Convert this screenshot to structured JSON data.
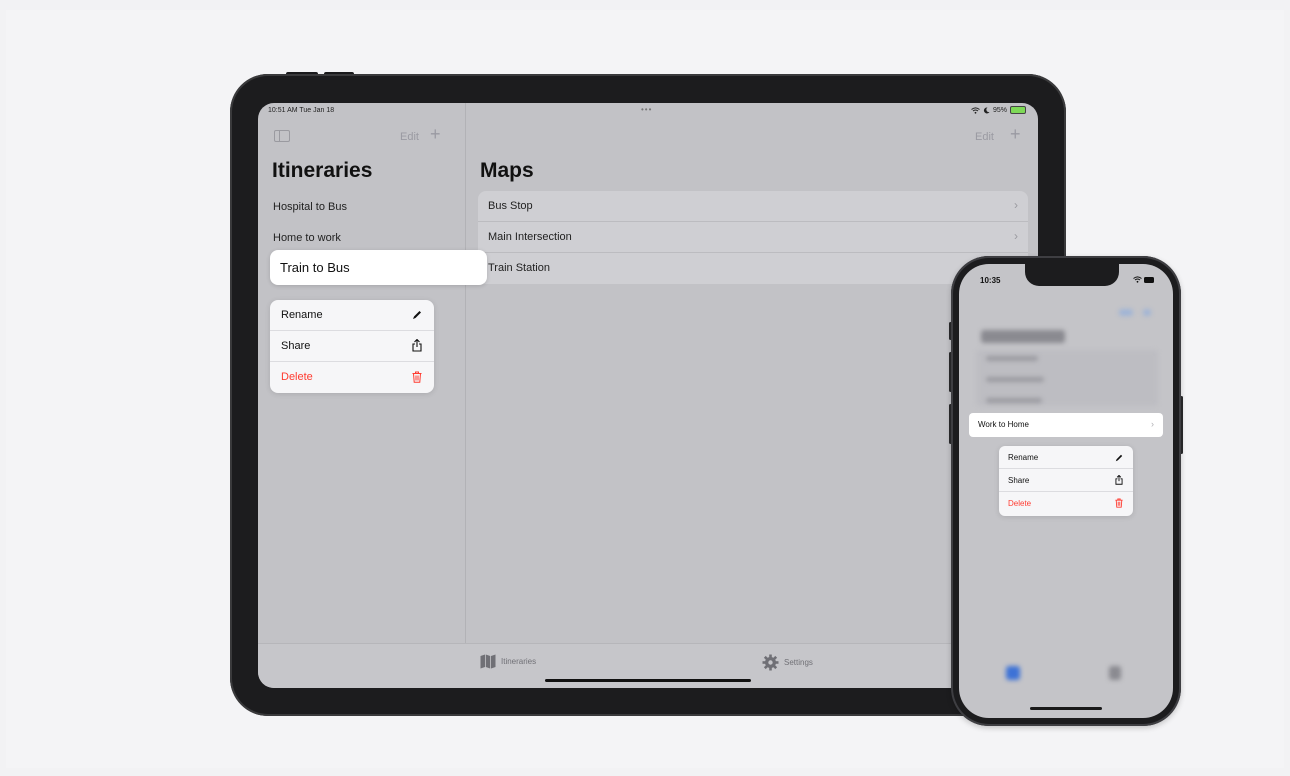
{
  "ipad": {
    "status": {
      "time": "10:51 AM  Tue Jan 18",
      "dots": "•••",
      "battery": "95%"
    },
    "sidebar": {
      "edit_label": "Edit",
      "plus": "+",
      "title": "Itineraries",
      "items": [
        "Hospital to Bus",
        "Home to work"
      ],
      "selected": "Train to Bus"
    },
    "context_menu": {
      "items": [
        {
          "label": "Rename",
          "icon": "pencil-icon"
        },
        {
          "label": "Share",
          "icon": "share-icon"
        },
        {
          "label": "Delete",
          "icon": "trash-icon"
        }
      ]
    },
    "maps": {
      "edit_label": "Edit",
      "plus": "+",
      "title": "Maps",
      "rows": [
        "Bus Stop",
        "Main Intersection",
        "Train Station"
      ],
      "chevron": "›"
    },
    "tabbar": {
      "itineraries": "Itineraries",
      "settings": "Settings"
    }
  },
  "iphone": {
    "status": {
      "time": "10:35"
    },
    "selected": "Work to Home",
    "chevron": "›",
    "context_menu": {
      "items": [
        {
          "label": "Rename",
          "icon": "pencil-icon"
        },
        {
          "label": "Share",
          "icon": "share-icon"
        },
        {
          "label": "Delete",
          "icon": "trash-icon"
        }
      ]
    }
  },
  "colors": {
    "destructive": "#ff3b30",
    "accent": "#1e6be0"
  }
}
